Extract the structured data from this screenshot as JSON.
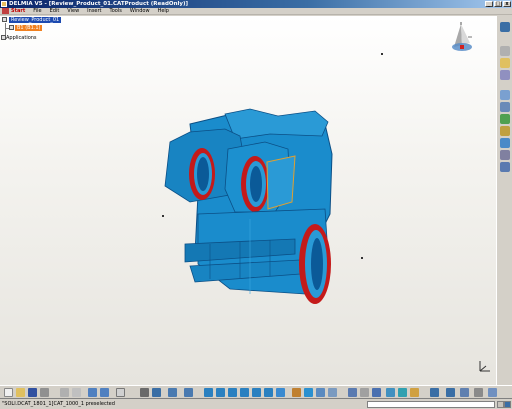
{
  "window": {
    "title": "DELMIA V5 - [Review_Product_01.CATProduct (ReadOnly)]",
    "controls": [
      "_",
      "□",
      "x"
    ]
  },
  "menubar": {
    "items": [
      "Start",
      "File",
      "Edit",
      "View",
      "Insert",
      "Tools",
      "Window",
      "Help"
    ]
  },
  "tree": {
    "root": "Review_Product_01",
    "child": "B1 (B1.1)",
    "applications": "Applications"
  },
  "statusbar": {
    "message": "\"SOLI.DCAT_1801_1[CAT_1000_1 preselected"
  },
  "colors": {
    "part_fill": "#1a8ccc",
    "part_shadow": "#0b4f86",
    "bore_ring": "#c41a1a",
    "selection_bg": "#1c4ab0",
    "child_bg": "#f08020"
  }
}
